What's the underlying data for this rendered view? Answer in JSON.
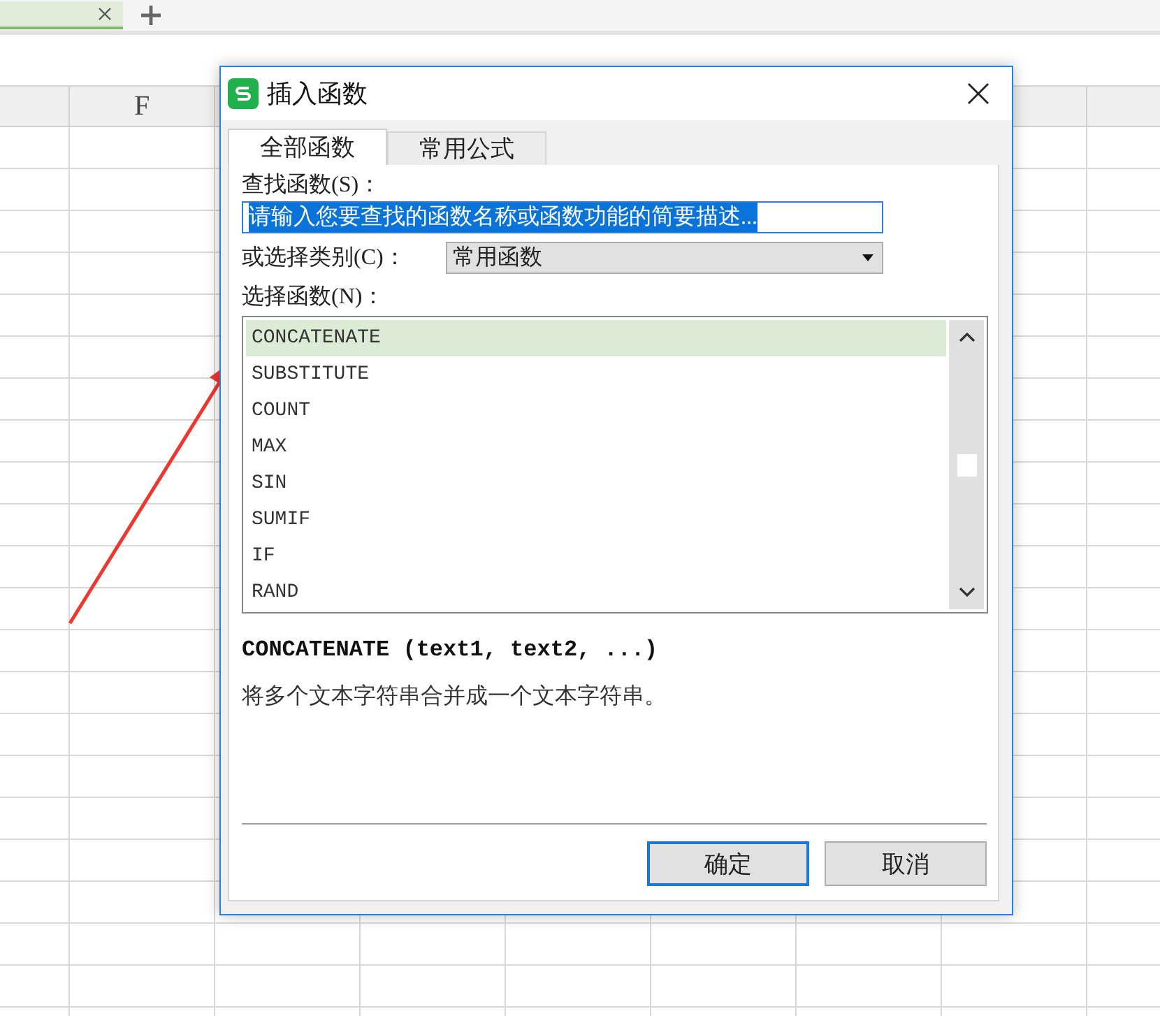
{
  "sheet": {
    "column_headers": [
      "F"
    ]
  },
  "dialog": {
    "title": "插入函数",
    "tabs": [
      {
        "label": "全部函数",
        "selected": true
      },
      {
        "label": "常用公式",
        "selected": false
      }
    ],
    "search": {
      "label": "查找函数(S)：",
      "value": "请输入您要查找的函数名称或函数功能的简要描述...",
      "highlighted": true
    },
    "category": {
      "label": "或选择类别(C)：",
      "value": "常用函数"
    },
    "function_list": {
      "label": "选择函数(N)：",
      "items": [
        {
          "name": "CONCATENATE",
          "selected": true
        },
        {
          "name": "SUBSTITUTE",
          "selected": false
        },
        {
          "name": "COUNT",
          "selected": false
        },
        {
          "name": "MAX",
          "selected": false
        },
        {
          "name": "SIN",
          "selected": false
        },
        {
          "name": "SUMIF",
          "selected": false
        },
        {
          "name": "IF",
          "selected": false
        },
        {
          "name": "RAND",
          "selected": false
        }
      ]
    },
    "signature": "CONCATENATE (text1, text2, ...)",
    "description": "将多个文本字符串合并成一个文本字符串。",
    "buttons": [
      {
        "label": "确定",
        "default": true
      },
      {
        "label": "取消",
        "default": false
      }
    ]
  }
}
